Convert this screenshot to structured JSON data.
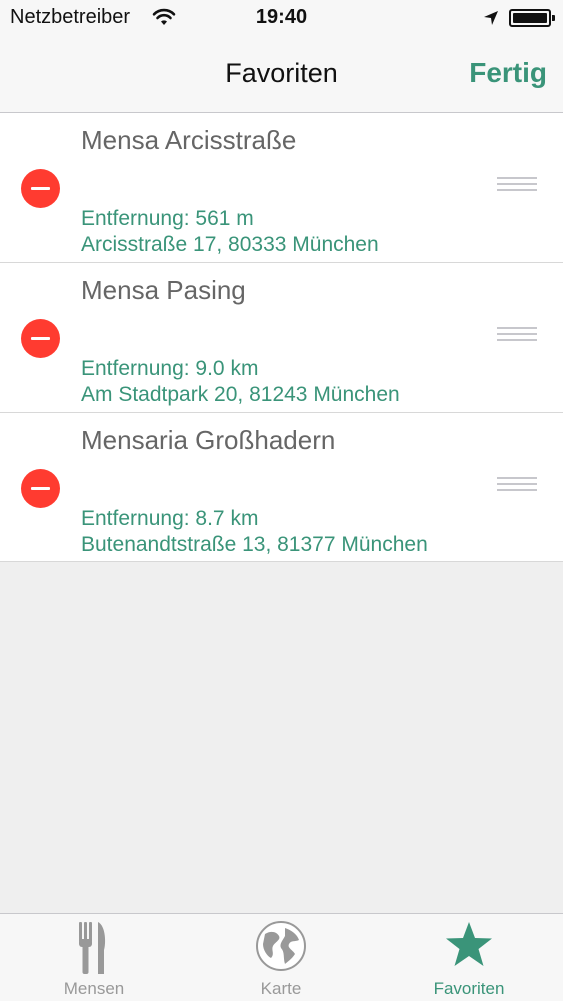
{
  "status_bar": {
    "carrier": "Netzbetreiber",
    "time": "19:40"
  },
  "nav": {
    "title": "Favoriten",
    "done_label": "Fertig"
  },
  "favorites": [
    {
      "name": "Mensa Arcisstraße",
      "distance": "Entfernung: 561 m",
      "address": "Arcisstraße 17, 80333 München"
    },
    {
      "name": "Mensa Pasing",
      "distance": "Entfernung: 9.0 km",
      "address": "Am Stadtpark 20, 81243 München"
    },
    {
      "name": "Mensaria Großhadern",
      "distance": "Entfernung: 8.7 km",
      "address": "Butenandtstraße 13, 81377 München"
    }
  ],
  "tabs": [
    {
      "label": "Mensen",
      "icon": "fork-knife-icon",
      "active": false
    },
    {
      "label": "Karte",
      "icon": "globe-icon",
      "active": false
    },
    {
      "label": "Favoriten",
      "icon": "star-icon",
      "active": true
    }
  ],
  "colors": {
    "accent": "#3a9479",
    "delete": "#ff3b30",
    "tab_inactive": "#999999"
  }
}
